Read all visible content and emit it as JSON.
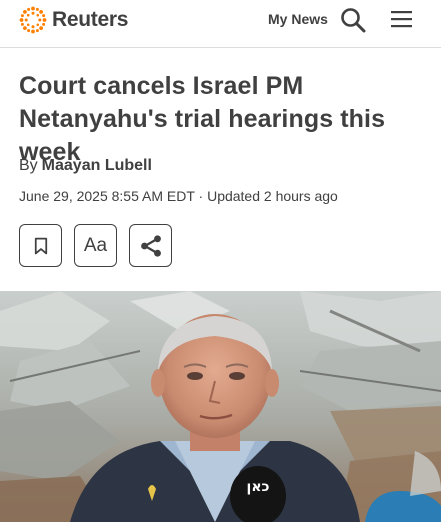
{
  "header": {
    "brand": "Reuters",
    "my_news_label": "My News"
  },
  "article": {
    "headline": "Court cancels Israel PM Netanyahu's trial hearings this week",
    "byline_prefix": "By",
    "author": "Maayan Lubell",
    "dateline": "June 29, 2025 8:55 AM EDT · Updated 2 hours ago"
  },
  "tools": {
    "text_size_label": "Aa"
  },
  "photo": {
    "microphone_label": "כאן"
  },
  "colors": {
    "text": "#404040",
    "brand_orange": "#ff8000",
    "divider": "#dcdcdc"
  },
  "icons": [
    "reuters-logo-icon",
    "search-icon",
    "menu-icon",
    "bookmark-icon",
    "share-icon"
  ]
}
